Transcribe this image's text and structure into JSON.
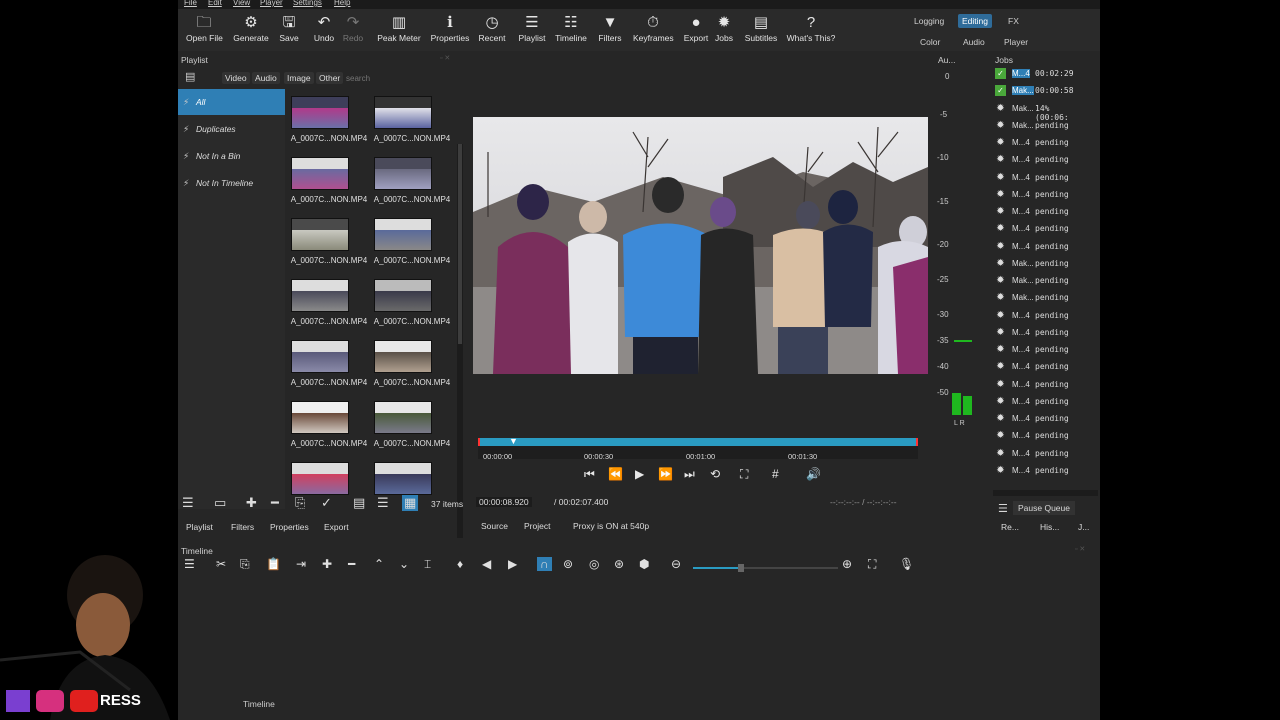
{
  "menu": [
    "File",
    "Edit",
    "View",
    "Player",
    "Settings",
    "Help"
  ],
  "toolbar": [
    {
      "label": "Open File",
      "icon": "folder-icon",
      "glyph": "🗀",
      "dim": false
    },
    {
      "label": "Generate",
      "icon": "generate-icon",
      "glyph": "⚙",
      "dim": false
    },
    {
      "label": "Save",
      "icon": "save-icon",
      "glyph": "🖫",
      "dim": false
    },
    {
      "label": "Undo",
      "icon": "undo-icon",
      "glyph": "↶",
      "dim": false
    },
    {
      "label": "Redo",
      "icon": "redo-icon",
      "glyph": "↷",
      "dim": true
    },
    {
      "label": "Peak Meter",
      "icon": "peak-meter-icon",
      "glyph": "▥",
      "dim": false
    },
    {
      "label": "Properties",
      "icon": "properties-icon",
      "glyph": "ℹ",
      "dim": false
    },
    {
      "label": "Recent",
      "icon": "recent-icon",
      "glyph": "◷",
      "dim": false
    },
    {
      "label": "Playlist",
      "icon": "playlist-icon",
      "glyph": "☰",
      "dim": false
    },
    {
      "label": "Timeline",
      "icon": "timeline-icon",
      "glyph": "☷",
      "dim": false
    },
    {
      "label": "Filters",
      "icon": "filter-icon",
      "glyph": "▼",
      "dim": false
    },
    {
      "label": "Keyframes",
      "icon": "keyframes-icon",
      "glyph": "⏱",
      "dim": false
    },
    {
      "label": "Export",
      "icon": "export-icon",
      "glyph": "●",
      "dim": false
    },
    {
      "label": "Jobs",
      "icon": "jobs-icon",
      "glyph": "✹",
      "dim": false
    },
    {
      "label": "Subtitles",
      "icon": "subtitles-icon",
      "glyph": "▤",
      "dim": false
    },
    {
      "label": "What's This?",
      "icon": "help-icon",
      "glyph": "?",
      "dim": false
    }
  ],
  "layouts": {
    "row1": [
      "Logging",
      "Editing",
      "FX"
    ],
    "row2": [
      "Color",
      "Audio",
      "Player"
    ],
    "active": "Editing"
  },
  "playlist": {
    "title": "Playlist",
    "tabs": [
      "Video",
      "Audio",
      "Image",
      "Other"
    ],
    "search_placeholder": "search",
    "bins": [
      "All",
      "Duplicates",
      "Not In a Bin",
      "Not In Timeline"
    ],
    "items": [
      "A_0007C...NON.MP4",
      "A_0007C...NON.MP4",
      "A_0007C...NON.MP4",
      "A_0007C...NON.MP4",
      "A_0007C...NON.MP4",
      "A_0007C...NON.MP4",
      "A_0007C...NON.MP4",
      "A_0007C...NON.MP4",
      "A_0007C...NON.MP4",
      "A_0007C...NON.MP4",
      "A_0007C...NON.MP4",
      "A_0007C...NON.MP4",
      "",
      ""
    ],
    "count": "37 items",
    "bottom_tabs": [
      "Playlist",
      "Filters",
      "Properties",
      "Export"
    ]
  },
  "player": {
    "ruler": [
      "00:00:00",
      "00:00:30",
      "00:01:00",
      "00:01:30"
    ],
    "current": "00:00:08.920",
    "duration": "/  00:02:07.400",
    "in_out": "--:--:--:--  /  --:--:--:--",
    "tabs": [
      "Source",
      "Project"
    ],
    "proxy": "Proxy is ON at 540p"
  },
  "audio": {
    "title": "Au...",
    "scale": [
      "0",
      "-5",
      "-10",
      "-15",
      "-20",
      "-25",
      "-30",
      "-35",
      "-40",
      "-50"
    ],
    "lr": "L R"
  },
  "jobs": {
    "title": "Jobs",
    "list": [
      {
        "name": "M...4",
        "status": "00:02:29",
        "state": "done",
        "hl": true
      },
      {
        "name": "Mak...",
        "status": "00:00:58",
        "state": "done",
        "hl": true
      },
      {
        "name": "Mak...",
        "status": "14% (00:06:",
        "state": "running",
        "hl": false
      },
      {
        "name": "Mak...",
        "status": "pending",
        "state": "pending",
        "hl": false
      },
      {
        "name": "M...4",
        "status": "pending",
        "state": "pending",
        "hl": false
      },
      {
        "name": "M...4",
        "status": "pending",
        "state": "pending",
        "hl": false
      },
      {
        "name": "M...4",
        "status": "pending",
        "state": "pending",
        "hl": false
      },
      {
        "name": "M...4",
        "status": "pending",
        "state": "pending",
        "hl": false
      },
      {
        "name": "M...4",
        "status": "pending",
        "state": "pending",
        "hl": false
      },
      {
        "name": "M...4",
        "status": "pending",
        "state": "pending",
        "hl": false
      },
      {
        "name": "M...4",
        "status": "pending",
        "state": "pending",
        "hl": false
      },
      {
        "name": "Mak...",
        "status": "pending",
        "state": "pending",
        "hl": false
      },
      {
        "name": "Mak...",
        "status": "pending",
        "state": "pending",
        "hl": false
      },
      {
        "name": "Mak...",
        "status": "pending",
        "state": "pending",
        "hl": false
      },
      {
        "name": "M...4",
        "status": "pending",
        "state": "pending",
        "hl": false
      },
      {
        "name": "M...4",
        "status": "pending",
        "state": "pending",
        "hl": false
      },
      {
        "name": "M...4",
        "status": "pending",
        "state": "pending",
        "hl": false
      },
      {
        "name": "M...4",
        "status": "pending",
        "state": "pending",
        "hl": false
      },
      {
        "name": "M...4",
        "status": "pending",
        "state": "pending",
        "hl": false
      },
      {
        "name": "M...4",
        "status": "pending",
        "state": "pending",
        "hl": false
      },
      {
        "name": "M...4",
        "status": "pending",
        "state": "pending",
        "hl": false
      },
      {
        "name": "M...4",
        "status": "pending",
        "state": "pending",
        "hl": false
      },
      {
        "name": "M...4",
        "status": "pending",
        "state": "pending",
        "hl": false
      },
      {
        "name": "M...4",
        "status": "pending",
        "state": "pending",
        "hl": false
      }
    ],
    "pause": "Pause Queue",
    "bottom": [
      "Re...",
      "His...",
      "J..."
    ]
  },
  "timeline": {
    "title": "Timeline",
    "footer": "Timeline"
  },
  "overlay": {
    "youtube": "RESS"
  },
  "colors": {
    "accent": "#2f7fb5",
    "panel": "#262626",
    "meter": "#1fb81f"
  }
}
